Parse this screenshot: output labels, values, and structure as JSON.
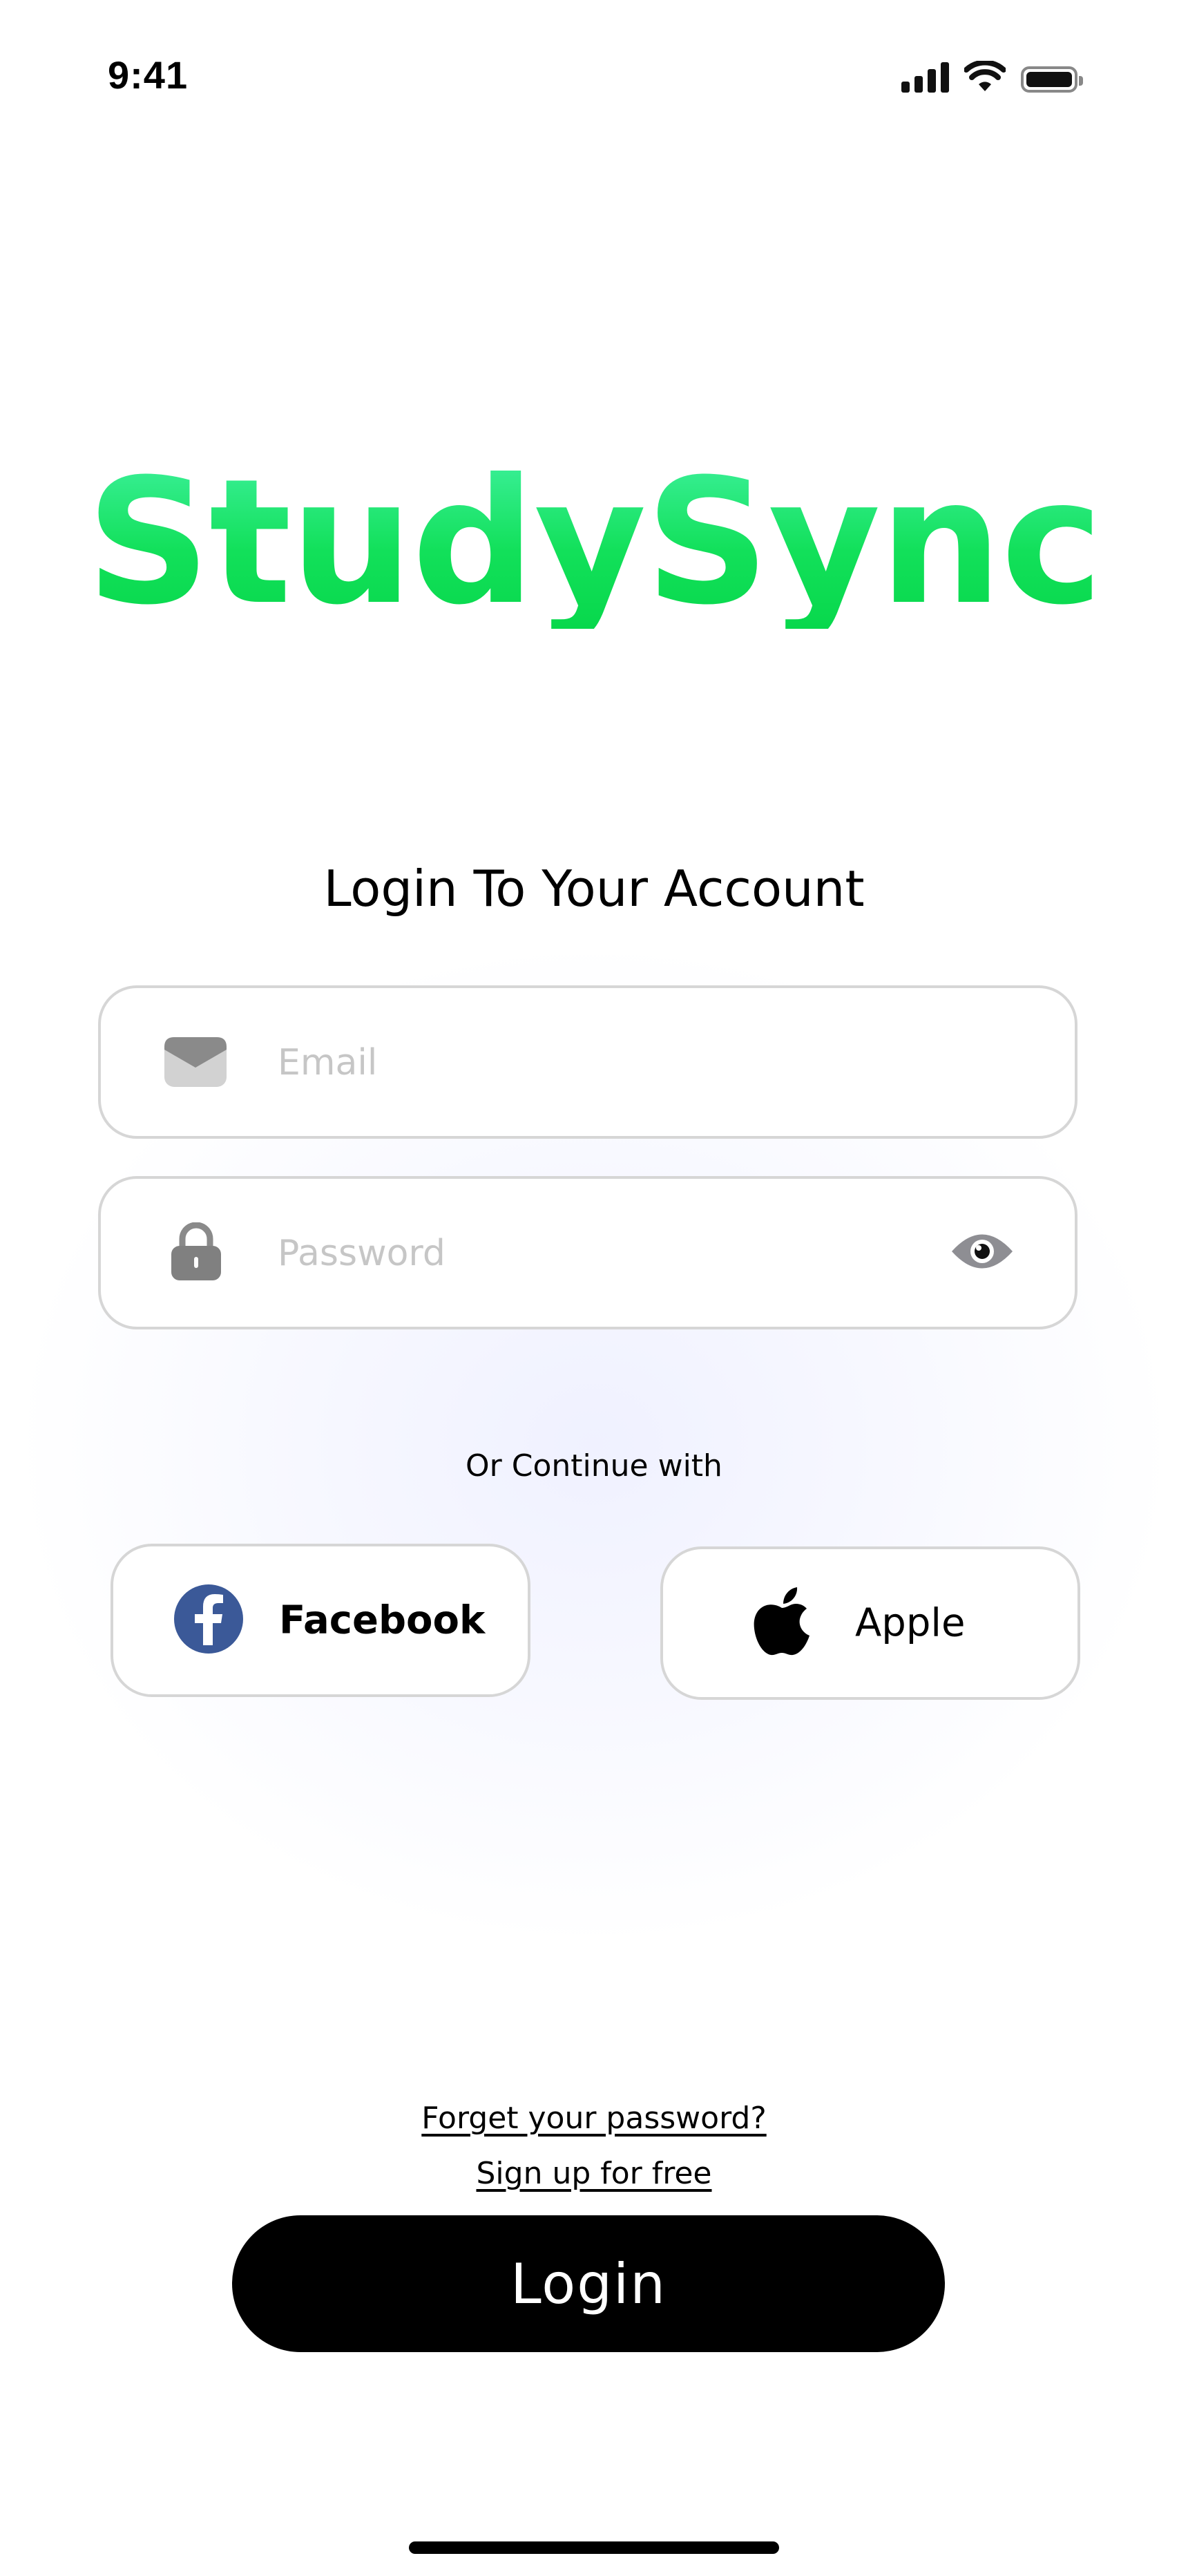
{
  "status_bar": {
    "time": "9:41"
  },
  "brand": {
    "name": "StudySync",
    "color": "#19e05a"
  },
  "login": {
    "heading": "Login To Your Account",
    "email": {
      "placeholder": "Email",
      "value": ""
    },
    "password": {
      "placeholder": "Password",
      "value": ""
    },
    "divider_text": "Or Continue with",
    "social": {
      "facebook_label": "Facebook",
      "apple_label": "Apple"
    },
    "forgot_link": "Forget your password?",
    "signup_link": "Sign up for free",
    "login_button": "Login"
  },
  "icons": [
    "signal-icon",
    "wifi-icon",
    "battery-icon",
    "mail-icon",
    "lock-icon",
    "eye-icon",
    "facebook-icon",
    "apple-icon"
  ]
}
